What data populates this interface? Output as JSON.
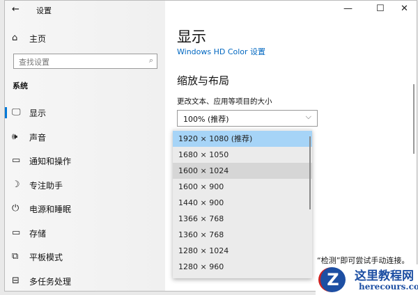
{
  "window": {
    "title": "设置",
    "back": "←",
    "minimize": "—",
    "maximize": "☐",
    "close": "✕"
  },
  "sidebar": {
    "home": "主页",
    "search_placeholder": "查找设置",
    "section": "系统",
    "items": [
      {
        "icon": "monitor-icon",
        "glyph": "🖵",
        "label": "显示"
      },
      {
        "icon": "speaker-icon",
        "glyph": "🕪",
        "label": "声音"
      },
      {
        "icon": "notification-icon",
        "glyph": "▭",
        "label": "通知和操作"
      },
      {
        "icon": "moon-icon",
        "glyph": "☽",
        "label": "专注助手"
      },
      {
        "icon": "power-icon",
        "glyph": "⏻",
        "label": "电源和睡眠"
      },
      {
        "icon": "storage-icon",
        "glyph": "▭",
        "label": "存储"
      },
      {
        "icon": "tablet-icon",
        "glyph": "⧉",
        "label": "平板模式"
      },
      {
        "icon": "multitask-icon",
        "glyph": "⊟",
        "label": "多任务处理"
      }
    ]
  },
  "main": {
    "title": "显示",
    "hd_link": "Windows HD Color 设置",
    "section": "缩放与布局",
    "scale_label": "更改文本、应用等项目的大小",
    "scale_value": "100% (推荐)",
    "detect_text": "“检测”即可尝试手动连接。"
  },
  "resolutions": [
    "1920 × 1080 (推荐)",
    "1680 × 1050",
    "1600 × 1024",
    "1600 × 900",
    "1440 × 900",
    "1366 × 768",
    "1360 × 768",
    "1280 × 1024",
    "1280 × 960"
  ],
  "watermark": {
    "name": "这里教程网",
    "url": "herecours.com"
  }
}
